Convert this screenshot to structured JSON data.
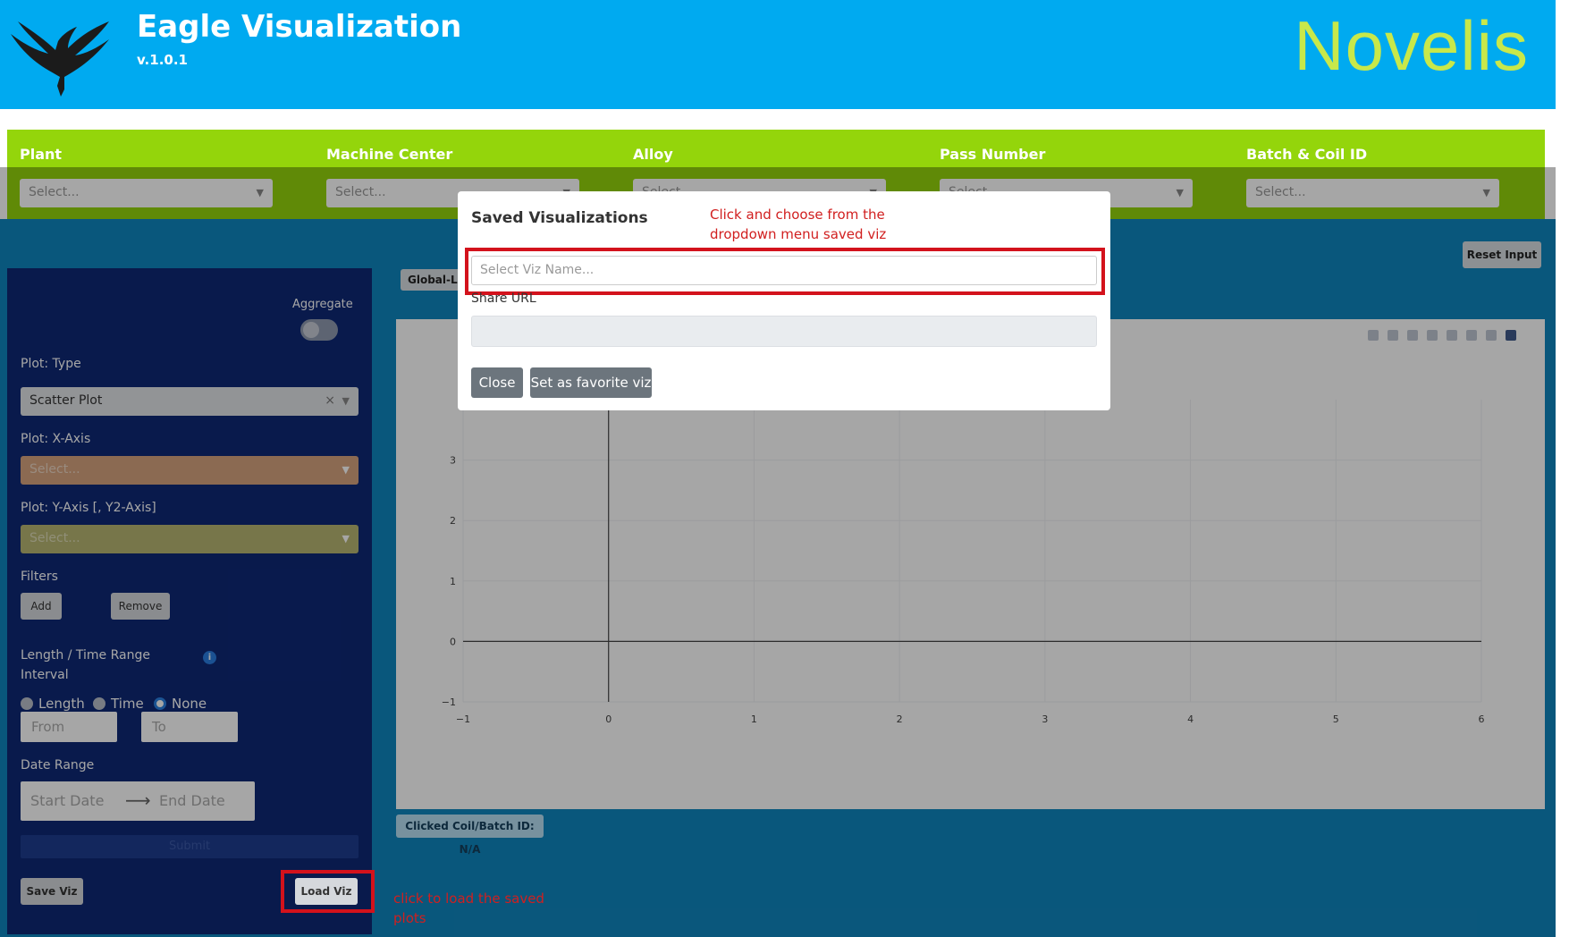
{
  "header": {
    "title": "Eagle Visualization",
    "version": "v.1.0.1",
    "brand": "Novelis"
  },
  "filters": [
    {
      "label": "Plant",
      "placeholder": "Select..."
    },
    {
      "label": "Machine Center",
      "placeholder": "Select..."
    },
    {
      "label": "Alloy",
      "placeholder": "Select..."
    },
    {
      "label": "Pass Number",
      "placeholder": "Select..."
    },
    {
      "label": "Batch & Coil ID",
      "placeholder": "Select..."
    }
  ],
  "sidebar": {
    "aggregate_label": "Aggregate",
    "plot_type_label": "Plot: Type",
    "plot_type_value": "Scatter Plot",
    "x_axis_label": "Plot: X-Axis",
    "x_axis_placeholder": "Select...",
    "y_axis_label": "Plot: Y-Axis [, Y2-Axis]",
    "y_axis_placeholder": "Select...",
    "filters_label": "Filters",
    "add_label": "Add",
    "remove_label": "Remove",
    "range_label_line1": "Length / Time Range",
    "range_label_line2": "Interval",
    "radio_options": [
      "Length",
      "Time",
      "None"
    ],
    "selected_radio": "None",
    "from_placeholder": "From",
    "to_placeholder": "To",
    "date_range_label": "Date Range",
    "start_date_placeholder": "Start Date",
    "end_date_placeholder": "End Date",
    "submit_label": "Submit",
    "save_viz_label": "Save Viz",
    "load_viz_label": "Load Viz"
  },
  "main": {
    "tab_label": "Global-Lo",
    "reset_label": "Reset Input",
    "clicked_label": "Clicked Coil/Batch ID: N/A"
  },
  "modal": {
    "title": "Saved Visualizations",
    "annotation_line1": "Click and choose from the",
    "annotation_line2": "dropdown menu saved viz",
    "select_placeholder": "Select Viz Name...",
    "share_url_label": "Share URL",
    "close_label": "Close",
    "favorite_label": "Set as favorite viz"
  },
  "load_annotation": {
    "line1": "click to load the saved",
    "line2": "plots"
  },
  "chart_data": {
    "type": "scatter",
    "x_ticks": [
      "−1",
      "0",
      "1",
      "2",
      "3",
      "4",
      "5",
      "6"
    ],
    "y_ticks": [
      "−1",
      "0",
      "1",
      "2",
      "3"
    ],
    "xlim": [
      -1,
      6
    ],
    "ylim": [
      -1,
      4
    ],
    "series": [],
    "grid": true
  },
  "colors": {
    "header_bg": "#00aaf0",
    "filterbar_bg": "#94d50b",
    "sidebar_bg": "#0e2876",
    "brand": "#c8e84a",
    "annotation_red": "#d11f1f"
  }
}
